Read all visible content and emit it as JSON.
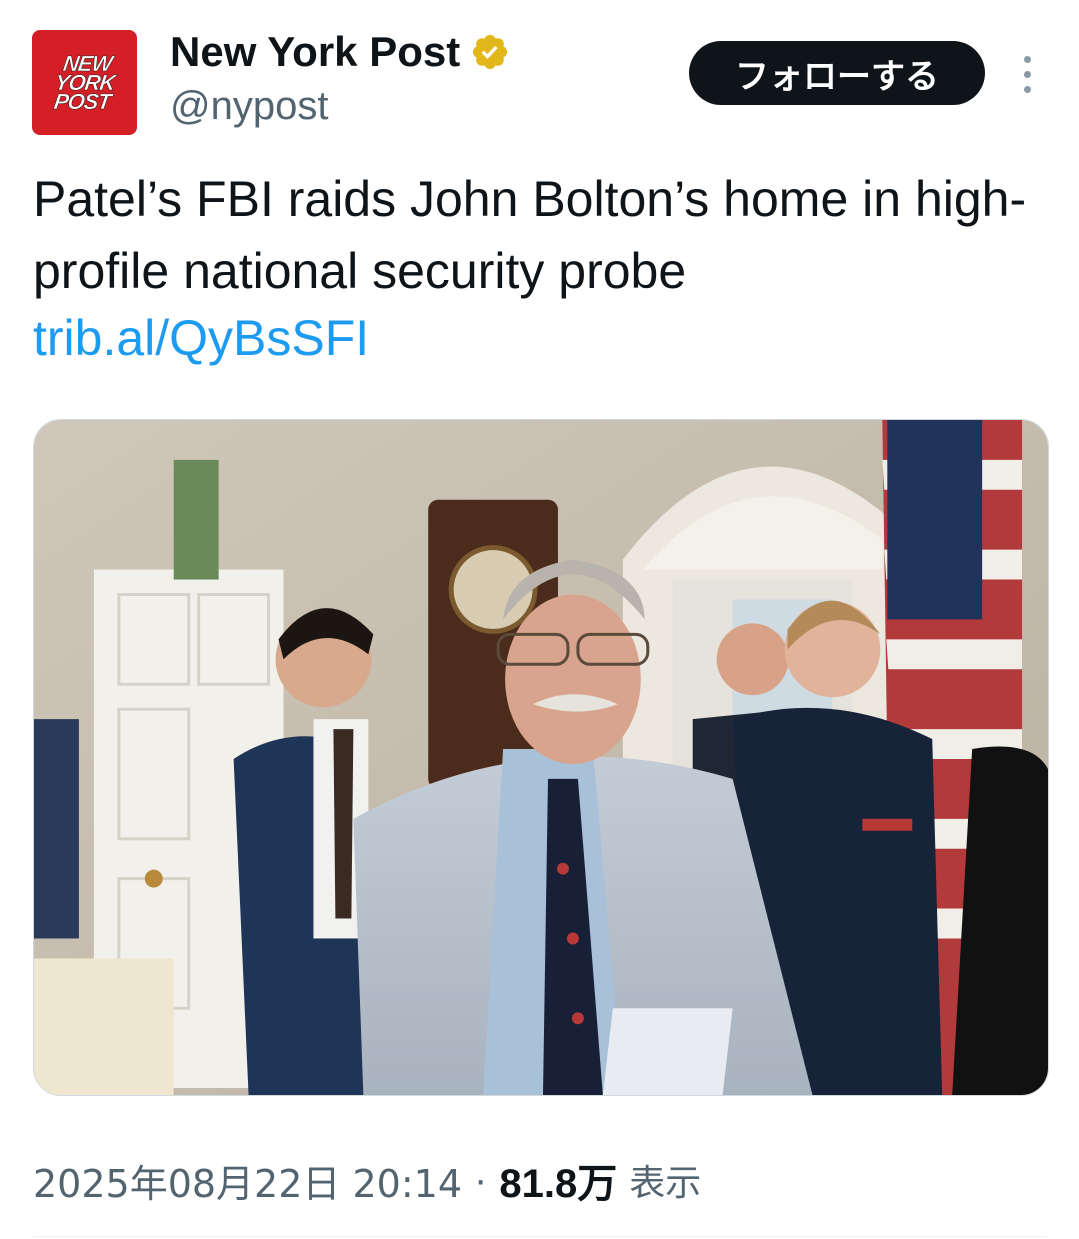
{
  "account": {
    "logo_lines": [
      "NEW",
      "YORK",
      "POST"
    ],
    "display_name": "New York Post",
    "handle": "@nypost",
    "verified_icon": "gold-verified-badge-icon",
    "verified_color": "#e2b719"
  },
  "actions": {
    "follow_label": "フォローする",
    "more_icon": "vertical-ellipsis-icon"
  },
  "tweet": {
    "text": "Patel’s FBI raids John Bolton’s home in high-profile national security probe",
    "link": "trib.al/QyBsSFI"
  },
  "media": {
    "type": "photo",
    "icon": "photo-image"
  },
  "meta": {
    "datetime": "2025年08月22日 20:14",
    "separator": "·",
    "views_count": "81.8万",
    "views_label": "表示"
  },
  "colors": {
    "accent_link": "#1d9bf0",
    "text_primary": "#0f1419",
    "text_secondary": "#536471",
    "brand_red": "#d41f27",
    "button_bg": "#0f1419"
  }
}
